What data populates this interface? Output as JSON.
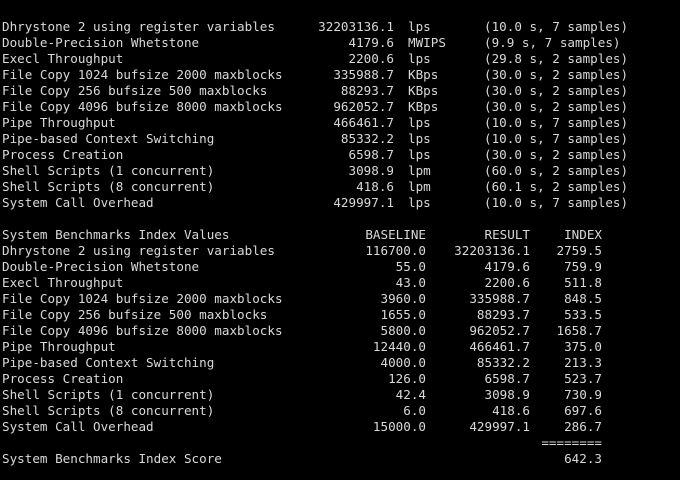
{
  "terminal": {
    "cut_line": "                    ...",
    "results": [
      {
        "name": "Dhrystone 2 using register variables",
        "value": "32203136.1",
        "unit": "lps",
        "detail": "(10.0 s, 7 samples)"
      },
      {
        "name": "Double-Precision Whetstone",
        "value": "4179.6",
        "unit": "MWIPS",
        "detail": "(9.9 s, 7 samples)"
      },
      {
        "name": "Execl Throughput",
        "value": "2200.6",
        "unit": "lps",
        "detail": "(29.8 s, 2 samples)"
      },
      {
        "name": "File Copy 1024 bufsize 2000 maxblocks",
        "value": "335988.7",
        "unit": "KBps",
        "detail": "(30.0 s, 2 samples)"
      },
      {
        "name": "File Copy 256 bufsize 500 maxblocks",
        "value": "88293.7",
        "unit": "KBps",
        "detail": "(30.0 s, 2 samples)"
      },
      {
        "name": "File Copy 4096 bufsize 8000 maxblocks",
        "value": "962052.7",
        "unit": "KBps",
        "detail": "(30.0 s, 2 samples)"
      },
      {
        "name": "Pipe Throughput",
        "value": "466461.7",
        "unit": "lps",
        "detail": "(10.0 s, 7 samples)"
      },
      {
        "name": "Pipe-based Context Switching",
        "value": "85332.2",
        "unit": "lps",
        "detail": "(10.0 s, 7 samples)"
      },
      {
        "name": "Process Creation",
        "value": "6598.7",
        "unit": "lps",
        "detail": "(30.0 s, 2 samples)"
      },
      {
        "name": "Shell Scripts (1 concurrent)",
        "value": "3098.9",
        "unit": "lpm",
        "detail": "(60.0 s, 2 samples)"
      },
      {
        "name": "Shell Scripts (8 concurrent)",
        "value": "418.6",
        "unit": "lpm",
        "detail": "(60.1 s, 2 samples)"
      },
      {
        "name": "System Call Overhead",
        "value": "429997.1",
        "unit": "lps",
        "detail": "(10.0 s, 7 samples)"
      }
    ],
    "index_header": {
      "title": "System Benchmarks Index Values",
      "baseline": "BASELINE",
      "result": "RESULT",
      "index": "INDEX"
    },
    "index_rows": [
      {
        "name": "Dhrystone 2 using register variables",
        "baseline": "116700.0",
        "result": "32203136.1",
        "index": "2759.5"
      },
      {
        "name": "Double-Precision Whetstone",
        "baseline": "55.0",
        "result": "4179.6",
        "index": "759.9"
      },
      {
        "name": "Execl Throughput",
        "baseline": "43.0",
        "result": "2200.6",
        "index": "511.8"
      },
      {
        "name": "File Copy 1024 bufsize 2000 maxblocks",
        "baseline": "3960.0",
        "result": "335988.7",
        "index": "848.5"
      },
      {
        "name": "File Copy 256 bufsize 500 maxblocks",
        "baseline": "1655.0",
        "result": "88293.7",
        "index": "533.5"
      },
      {
        "name": "File Copy 4096 bufsize 8000 maxblocks",
        "baseline": "5800.0",
        "result": "962052.7",
        "index": "1658.7"
      },
      {
        "name": "Pipe Throughput",
        "baseline": "12440.0",
        "result": "466461.7",
        "index": "375.0"
      },
      {
        "name": "Pipe-based Context Switching",
        "baseline": "4000.0",
        "result": "85332.2",
        "index": "213.3"
      },
      {
        "name": "Process Creation",
        "baseline": "126.0",
        "result": "6598.7",
        "index": "523.7"
      },
      {
        "name": "Shell Scripts (1 concurrent)",
        "baseline": "42.4",
        "result": "3098.9",
        "index": "730.9"
      },
      {
        "name": "Shell Scripts (8 concurrent)",
        "baseline": "6.0",
        "result": "418.6",
        "index": "697.6"
      },
      {
        "name": "System Call Overhead",
        "baseline": "15000.0",
        "result": "429997.1",
        "index": "286.7"
      }
    ],
    "separator": "========",
    "score": {
      "label": "System Benchmarks Index Score",
      "value": "642.3"
    },
    "colors": {
      "background": "#000000",
      "text": "#d9d9d9"
    }
  }
}
